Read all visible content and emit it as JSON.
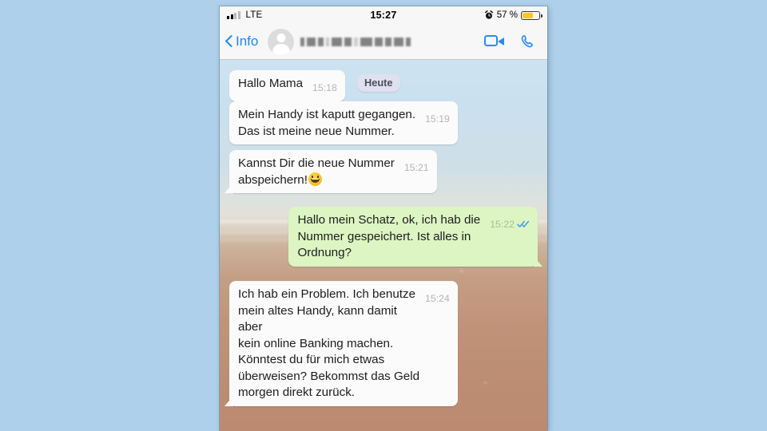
{
  "background": {
    "color": "#aed0ea"
  },
  "phone": {
    "status_bar": {
      "signal_icon": "cellular-signal-icon",
      "carrier_network": "LTE",
      "time": "15:27",
      "alarm_icon": "alarm-clock-icon",
      "battery_percent": "57 %",
      "battery_level": 57,
      "battery_color": "#fcc72c"
    },
    "nav_bar": {
      "back_icon": "chevron-left-icon",
      "back_label": "Info",
      "avatar_icon": "contact-avatar-placeholder-icon",
      "contact_name": "",
      "contact_name_state": "blurred",
      "video_call_icon": "video-camera-icon",
      "voice_call_icon": "phone-handset-icon",
      "accent_color": "#2e8bf0"
    },
    "chat": {
      "date_badge": "Heute",
      "messages": [
        {
          "text": "Hallo Mama",
          "time": "15:18",
          "direction": "incoming",
          "emoji": "",
          "tail": false
        },
        {
          "text": "Mein Handy ist kaputt gegangen.\nDas ist meine neue Nummer.",
          "time": "15:19",
          "direction": "incoming",
          "emoji": "",
          "tail": false
        },
        {
          "text": "Kannst Dir die neue Nummer\nabspeichern!",
          "time": "15:21",
          "direction": "incoming",
          "emoji": "grinning-face",
          "tail": true
        },
        {
          "text": "Hallo mein Schatz, ok, ich hab die\nNummer gespeichert. Ist alles in\nOrdnung?",
          "time": "15:22",
          "direction": "outgoing",
          "emoji": "",
          "tail": true,
          "receipt": "read-double-check"
        },
        {
          "text": "Ich hab ein Problem. Ich benutze\nmein altes Handy, kann damit aber\nkein online Banking machen.\nKönntest du für mich etwas\nüberweisen? Bekommst das Geld\nmorgen direkt zurück.",
          "time": "15:24",
          "direction": "incoming",
          "emoji": "",
          "tail": true
        }
      ],
      "bubble_color_incoming": "#fbfbfb",
      "bubble_color_outgoing": "#dcf5c2",
      "read_receipt_color": "#4fa3e3"
    }
  }
}
